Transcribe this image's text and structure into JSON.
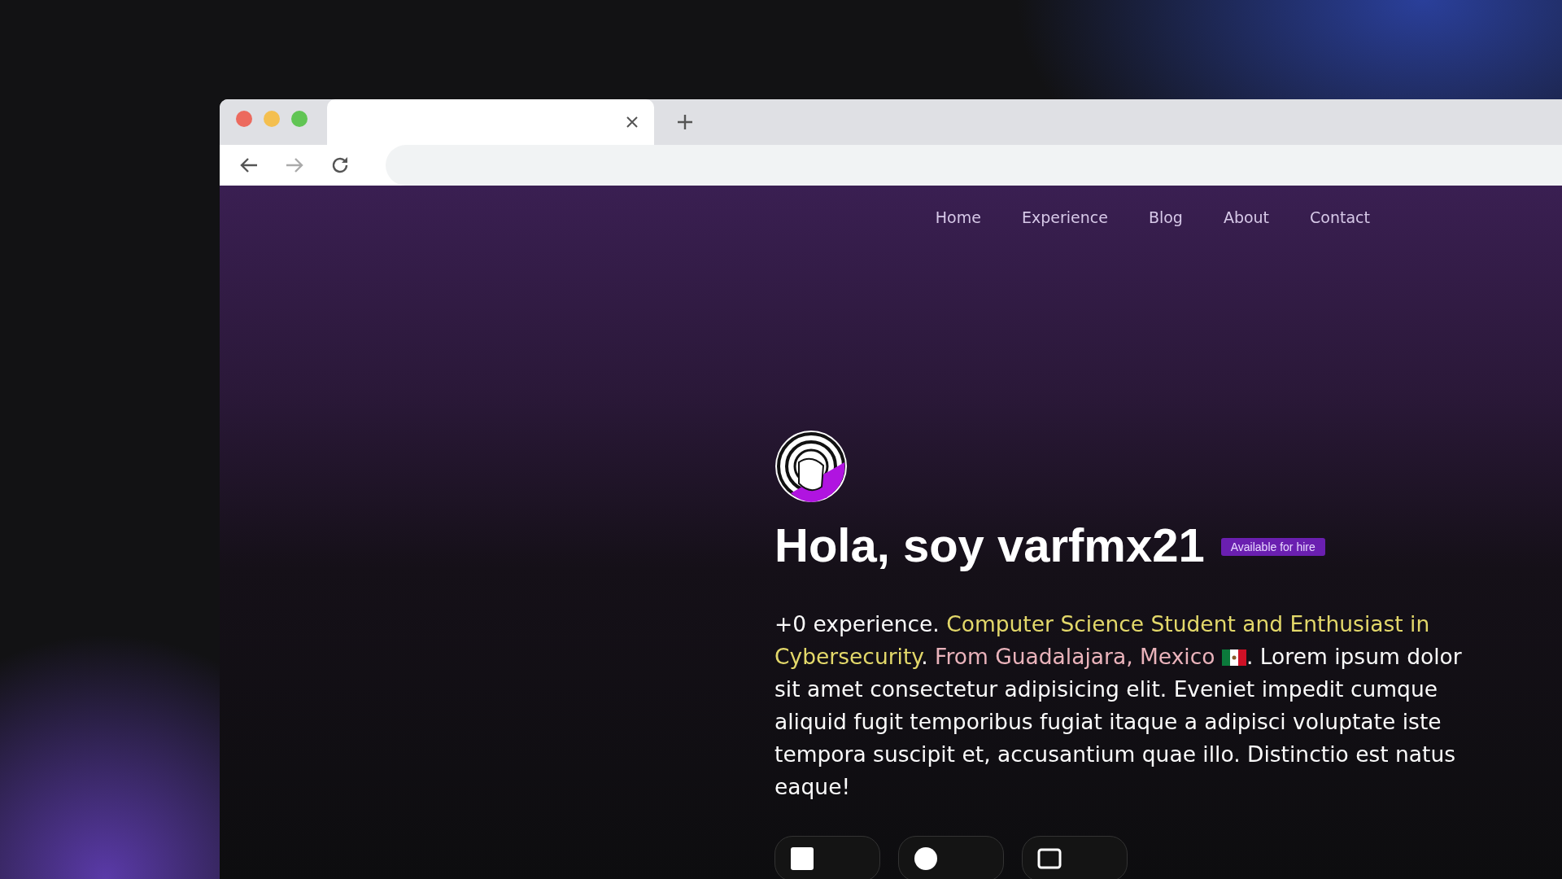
{
  "nav": {
    "items": [
      {
        "label": "Home"
      },
      {
        "label": "Experience"
      },
      {
        "label": "Blog"
      },
      {
        "label": "About"
      },
      {
        "label": "Contact"
      }
    ]
  },
  "hero": {
    "title": "Hola, soy varfmx21",
    "badge": "Available for hire",
    "intro": [
      {
        "kind": "plain",
        "text": "+0 experience. "
      },
      {
        "kind": "highlight",
        "text": "Computer Science Student and Enthusiast in Cybersecurity"
      },
      {
        "kind": "plain",
        "text": ". "
      },
      {
        "kind": "place",
        "text": "From Guadalajara, Mexico"
      },
      {
        "kind": "flag"
      },
      {
        "kind": "plain",
        "text": ". Lorem ipsum dolor sit amet consectetur adipisicing elit. Eveniet impedit cumque aliquid fugit temporibus fugiat itaque a adipisci voluptate iste tempora suscipit et, accusantium quae illo. Distinctio est natus eaque!"
      }
    ]
  }
}
